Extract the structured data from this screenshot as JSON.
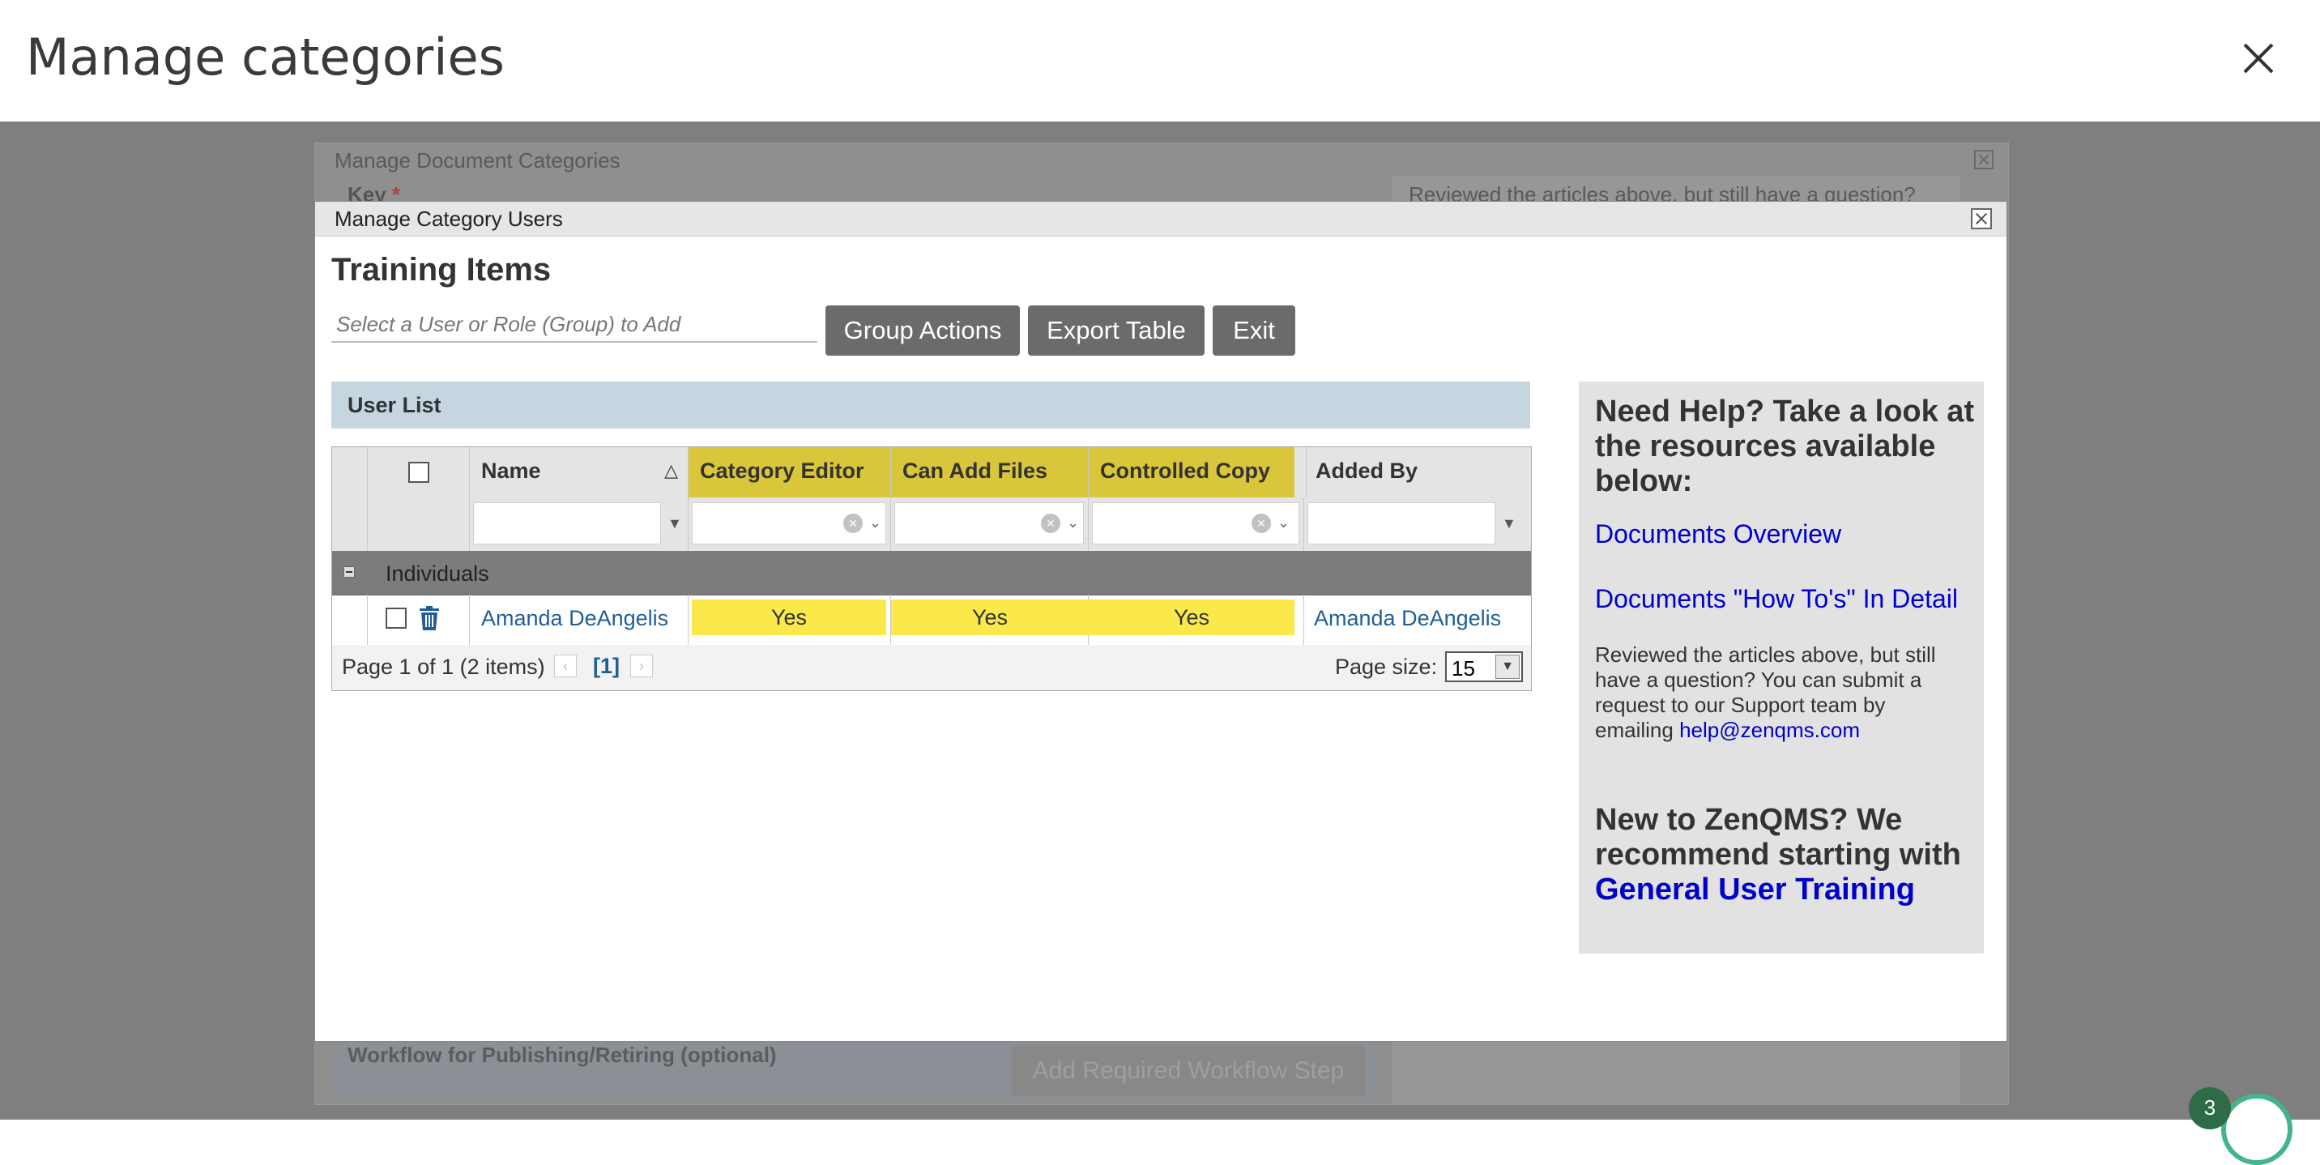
{
  "page": {
    "title": "Manage categories"
  },
  "background_dialog": {
    "title": "Manage Document Categories",
    "key_label": "Key",
    "required_mark": "*",
    "help_text": "Reviewed the articles above, but still have a question?",
    "workflow_label": "Workflow for Publishing/Retiring (optional)",
    "workflow_button": "Add Required Workflow Step"
  },
  "dialog": {
    "title": "Manage Category Users",
    "section_title": "Training Items",
    "user_select_placeholder": "Select a User or Role (Group) to Add",
    "buttons": {
      "group_actions": "Group Actions",
      "export_table": "Export Table",
      "exit": "Exit"
    },
    "user_list_label": "User List",
    "grid": {
      "columns": [
        "Name",
        "Category Editor",
        "Can Add Files",
        "Controlled Copy",
        "Added By"
      ],
      "sort_indicator": "△",
      "group_label": "Individuals",
      "rows": [
        {
          "name": "Amanda DeAngelis",
          "category_editor": "Yes",
          "can_add_files": "Yes",
          "controlled_copy": "Yes",
          "added_by": "Amanda DeAngelis"
        }
      ],
      "pager": {
        "summary": "Page 1 of 1 (2 items)",
        "current_page": "[1]",
        "page_size_label": "Page size:",
        "page_size": "15"
      }
    }
  },
  "help": {
    "heading": "Need Help? Take a look at the resources available below:",
    "link1": "Documents Overview",
    "link2": "Documents \"How To's\" In Detail",
    "text": "Reviewed the articles above, but still have a question? You can submit a request to our Support team by emailing",
    "email": "help@zenqms.com",
    "new_prefix": "New to ZenQMS? We recommend starting with",
    "new_link": "General User Training"
  },
  "chat": {
    "badge_count": "3"
  },
  "colors": {
    "highlight_header": "#d9c63a",
    "highlight_cell": "#fbe84a",
    "link": "#1f5f96",
    "help_link": "#0000cc",
    "button": "#6b6b6b"
  }
}
